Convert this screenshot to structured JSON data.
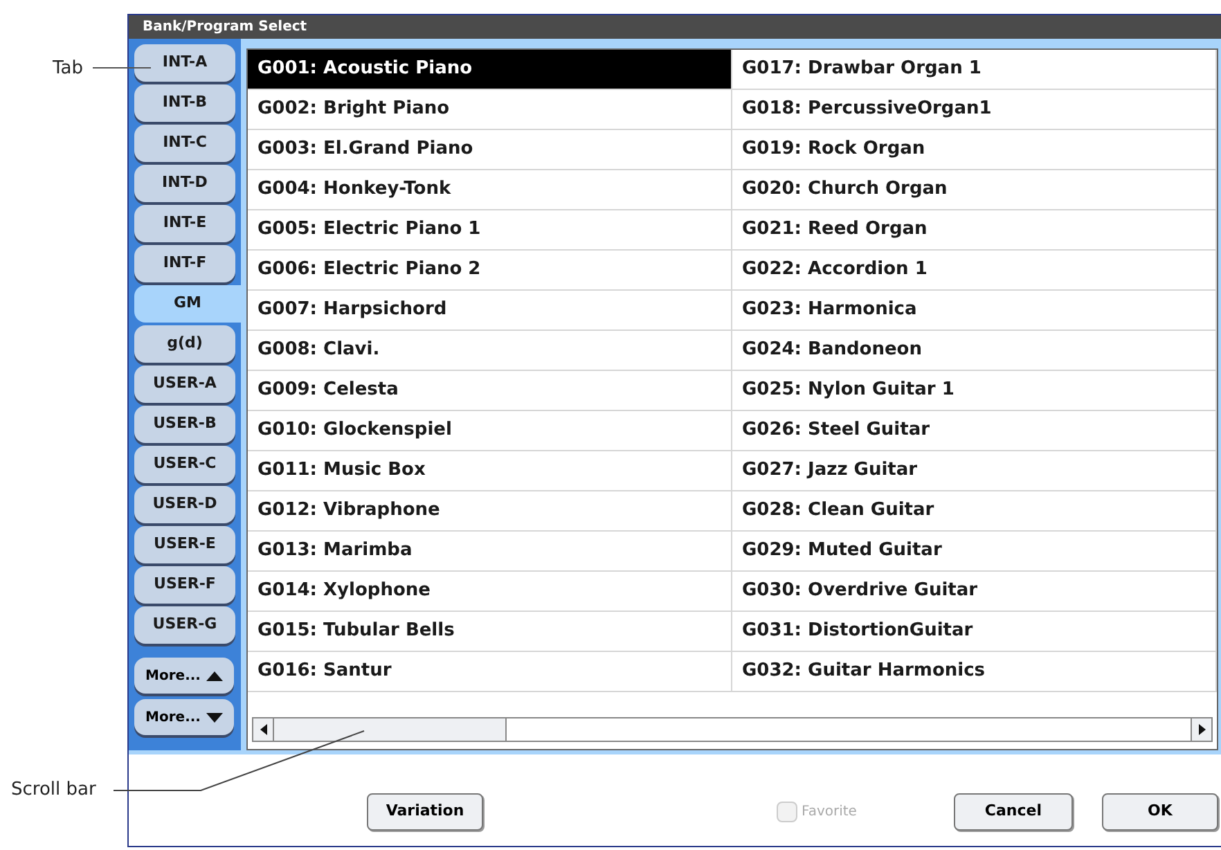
{
  "annotations": [
    {
      "kind": "tab",
      "label": "Tab"
    },
    {
      "kind": "scroll",
      "label": "Scroll bar"
    }
  ],
  "window": {
    "title": "Bank/Program Select"
  },
  "tabs": [
    {
      "label": "INT-A",
      "selected": false
    },
    {
      "label": "INT-B",
      "selected": false
    },
    {
      "label": "INT-C",
      "selected": false
    },
    {
      "label": "INT-D",
      "selected": false
    },
    {
      "label": "INT-E",
      "selected": false
    },
    {
      "label": "INT-F",
      "selected": false
    },
    {
      "label": "GM",
      "selected": true
    },
    {
      "label": "g(d)",
      "selected": false
    },
    {
      "label": "USER-A",
      "selected": false
    },
    {
      "label": "USER-B",
      "selected": false
    },
    {
      "label": "USER-C",
      "selected": false
    },
    {
      "label": "USER-D",
      "selected": false
    },
    {
      "label": "USER-E",
      "selected": false
    },
    {
      "label": "USER-F",
      "selected": false
    },
    {
      "label": "USER-G",
      "selected": false
    }
  ],
  "more_buttons": [
    {
      "label": "More...",
      "kind": "up"
    },
    {
      "label": "More...",
      "kind": "down"
    }
  ],
  "programs": [
    {
      "name": "G001: Acoustic Piano",
      "selected": true
    },
    {
      "name": "G002: Bright Piano",
      "selected": false
    },
    {
      "name": "G003: El.Grand Piano",
      "selected": false
    },
    {
      "name": "G004: Honkey-Tonk",
      "selected": false
    },
    {
      "name": "G005: Electric Piano 1",
      "selected": false
    },
    {
      "name": "G006: Electric Piano 2",
      "selected": false
    },
    {
      "name": "G007: Harpsichord",
      "selected": false
    },
    {
      "name": "G008: Clavi.",
      "selected": false
    },
    {
      "name": "G009: Celesta",
      "selected": false
    },
    {
      "name": "G010: Glockenspiel",
      "selected": false
    },
    {
      "name": "G011: Music Box",
      "selected": false
    },
    {
      "name": "G012: Vibraphone",
      "selected": false
    },
    {
      "name": "G013: Marimba",
      "selected": false
    },
    {
      "name": "G014: Xylophone",
      "selected": false
    },
    {
      "name": "G015: Tubular Bells",
      "selected": false
    },
    {
      "name": "G016: Santur",
      "selected": false
    },
    {
      "name": "G017: Drawbar Organ 1",
      "selected": false
    },
    {
      "name": "G018: PercussiveOrgan1",
      "selected": false
    },
    {
      "name": "G019: Rock Organ",
      "selected": false
    },
    {
      "name": "G020: Church Organ",
      "selected": false
    },
    {
      "name": "G021: Reed Organ",
      "selected": false
    },
    {
      "name": "G022: Accordion 1",
      "selected": false
    },
    {
      "name": "G023: Harmonica",
      "selected": false
    },
    {
      "name": "G024: Bandoneon",
      "selected": false
    },
    {
      "name": "G025: Nylon Guitar 1",
      "selected": false
    },
    {
      "name": "G026: Steel Guitar",
      "selected": false
    },
    {
      "name": "G027: Jazz Guitar",
      "selected": false
    },
    {
      "name": "G028: Clean Guitar",
      "selected": false
    },
    {
      "name": "G029: Muted Guitar",
      "selected": false
    },
    {
      "name": "G030: Overdrive Guitar",
      "selected": false
    },
    {
      "name": "G031: DistortionGuitar",
      "selected": false
    },
    {
      "name": "G032: Guitar Harmonics",
      "selected": false
    }
  ],
  "favorite": {
    "label": "Favorite",
    "checked": false,
    "disabled": true
  },
  "buttons": [
    {
      "kind": "variation",
      "label": "Variation"
    },
    {
      "kind": "cancel",
      "label": "Cancel"
    },
    {
      "kind": "ok",
      "label": "OK"
    }
  ]
}
